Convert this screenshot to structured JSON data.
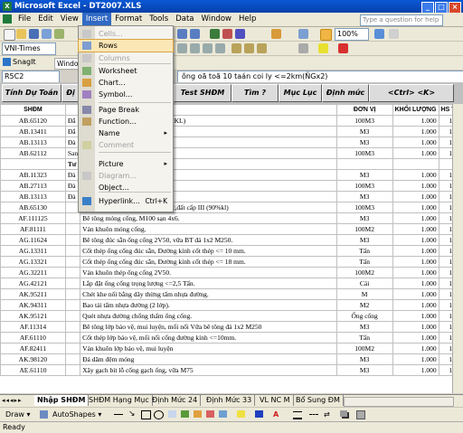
{
  "window": {
    "title": "Microsoft Excel - DT2007.XLS"
  },
  "menubar": [
    "File",
    "Edit",
    "View",
    "Insert",
    "Format",
    "Tools",
    "Data",
    "Window",
    "Help"
  ],
  "help_placeholder": "Type a question for help",
  "font_name": "VNI-Times",
  "zoom": "100%",
  "snagit": {
    "label": "SnagIt",
    "window": "Window"
  },
  "name_box": "R5C2",
  "formula": "ông oã toã 10 taán  coi ly <=2km(ÑGx2)",
  "macro_buttons": [
    "Tính Dự Toán",
    "Đị",
    "Test SHĐM",
    "Tìm ?",
    "Mục Lục",
    "Định mức",
    "<Ctrl> <K>"
  ],
  "insert_menu": [
    {
      "label": "Cells...",
      "disabled": true,
      "icon": "cells-icon"
    },
    {
      "label": "Rows",
      "highlighted": true,
      "icon": "rows-icon"
    },
    {
      "label": "Columns",
      "disabled": true,
      "icon": "columns-icon"
    },
    {
      "label": "Worksheet",
      "icon": "worksheet-icon"
    },
    {
      "label": "Chart...",
      "icon": "chart-icon"
    },
    {
      "label": "Symbol...",
      "icon": "symbol-icon"
    },
    {
      "label": "Page Break",
      "icon": "page-break-icon"
    },
    {
      "label": "Function...",
      "icon": "function-icon"
    },
    {
      "label": "Name",
      "submenu": true
    },
    {
      "label": "Comment",
      "disabled": true,
      "icon": "comment-icon"
    },
    {
      "label": "Picture",
      "submenu": true
    },
    {
      "label": "Diagram...",
      "disabled": true,
      "icon": "diagram-icon"
    },
    {
      "label": "Object..."
    },
    {
      "label": "Hyperlink...",
      "shortcut": "Ctrl+K",
      "icon": "hyperlink-icon"
    }
  ],
  "table": {
    "headers": [
      "SHĐM",
      "",
      "NG MỤC CÔNG TÁC",
      "ĐƠN VỊ",
      "KHỐI LƯỢNG",
      "HS VC"
    ],
    "rows": [
      [
        "AB.65120",
        "Đắ",
        "NG MỤC CÔNG TÁC) III (40% KL)",
        "100M3",
        "1.000",
        "1"
      ],
      [
        "AB.13411",
        "Đắ",
        "đầm chặt",
        "M3",
        "1.000",
        "1"
      ],
      [
        "AB.13113",
        "Đà",
        "cấp III bằng thủ công (20% KL)",
        "M3",
        "1.000",
        "1"
      ],
      [
        "AB.62112",
        "San",
        "cấp III (40% )",
        "100M3",
        "1.000",
        "1"
      ],
      [
        "",
        "Tư",
        "",
        "",
        "",
        ""
      ],
      [
        "AB.11323",
        "Đà",
        "Đất cấp III (10% KL)",
        "M3",
        "1.000",
        "1"
      ],
      [
        "AB.27113",
        "Đà",
        "ất cấp III (90%KL)",
        "100M3",
        "1.000",
        "1"
      ],
      [
        "AB.13113",
        "Đà",
        "(10%KL)",
        "M3",
        "1.000",
        "1"
      ],
      [
        "AB.65130",
        "",
        "Đắp đất móng cống bằng đầm cóc,đất cấp III (90%kl)",
        "100M3",
        "1.000",
        "1"
      ],
      [
        "AF.111125",
        "",
        "Bê tông móng cống, M100 sạn 4x6.",
        "M3",
        "1.000",
        "1"
      ],
      [
        "AF.81111",
        "",
        "Ván khuôn móng cống.",
        "100M2",
        "1.000",
        "1"
      ],
      [
        "AG.11624",
        "",
        "Bê tông đúc sẵn ống cống 2V50, vữa BT đá 1x2 M250.",
        "M3",
        "1.000",
        "1"
      ],
      [
        "AG.13311",
        "",
        "Cốt thép ống cống đúc sẵn, Đường kính cốt thép <= 10 mm.",
        "Tấn",
        "1.000",
        "1"
      ],
      [
        "AG.13321",
        "",
        "Cốt thép ống cống đúc sẵn, Đường kính cốt thép <= 18 mm.",
        "Tấn",
        "1.000",
        "1"
      ],
      [
        "AG.32211",
        "",
        "Ván khuôn thép ống cống 2V50.",
        "100M2",
        "1.000",
        "1"
      ],
      [
        "AG.42121",
        "",
        "Lắp đặt ống cống trọng lượng <=2,5 Tấn.",
        "Cái",
        "1.000",
        "1"
      ],
      [
        "AK.95211",
        "",
        "Chét khe nối bằng dây thừng tẩm nhựa đường.",
        "M",
        "1.000",
        "1"
      ],
      [
        "AK.94311",
        "",
        "Bao tải tẩm nhựa đường (2 lớp).",
        "M2",
        "1.000",
        "1"
      ],
      [
        "AK.95121",
        "",
        "Quét nhựa đường chống thấm ống cống.",
        "Ống cống",
        "1.000",
        "1"
      ],
      [
        "AF.11314",
        "",
        "Bê tông lớp bảo vệ, mui luyện, mối nối Vữa bê tông đá 1x2 M250",
        "M3",
        "1.000",
        "1"
      ],
      [
        "AF.61110",
        "",
        "Cốt thép lớp bảo vệ, mối nối cống đường kính <=10mm.",
        "Tấn",
        "1.000",
        "1"
      ],
      [
        "AF.82411",
        "",
        "Ván khuôn lớp bảo vệ, mui luyện",
        "100M2",
        "1.000",
        "1"
      ],
      [
        "AK.98120",
        "",
        "Đá dăm đệm móng",
        "M3",
        "1.000",
        "1"
      ],
      [
        "AE.61110",
        "",
        "Xây gạch bít lỗ cống gạch ống, vữa M75",
        "M3",
        "1.000",
        "1"
      ]
    ]
  },
  "sheet_tabs": [
    "Nhập SHĐM",
    "SHĐM Hạng Mục",
    "Định Mức 24",
    "Định Mức 33",
    "VL NC M",
    "Bổ Sung ĐM"
  ],
  "drawbar": {
    "draw": "Draw ▾",
    "autoshapes": "AutoShapes ▾"
  },
  "status": "Ready"
}
